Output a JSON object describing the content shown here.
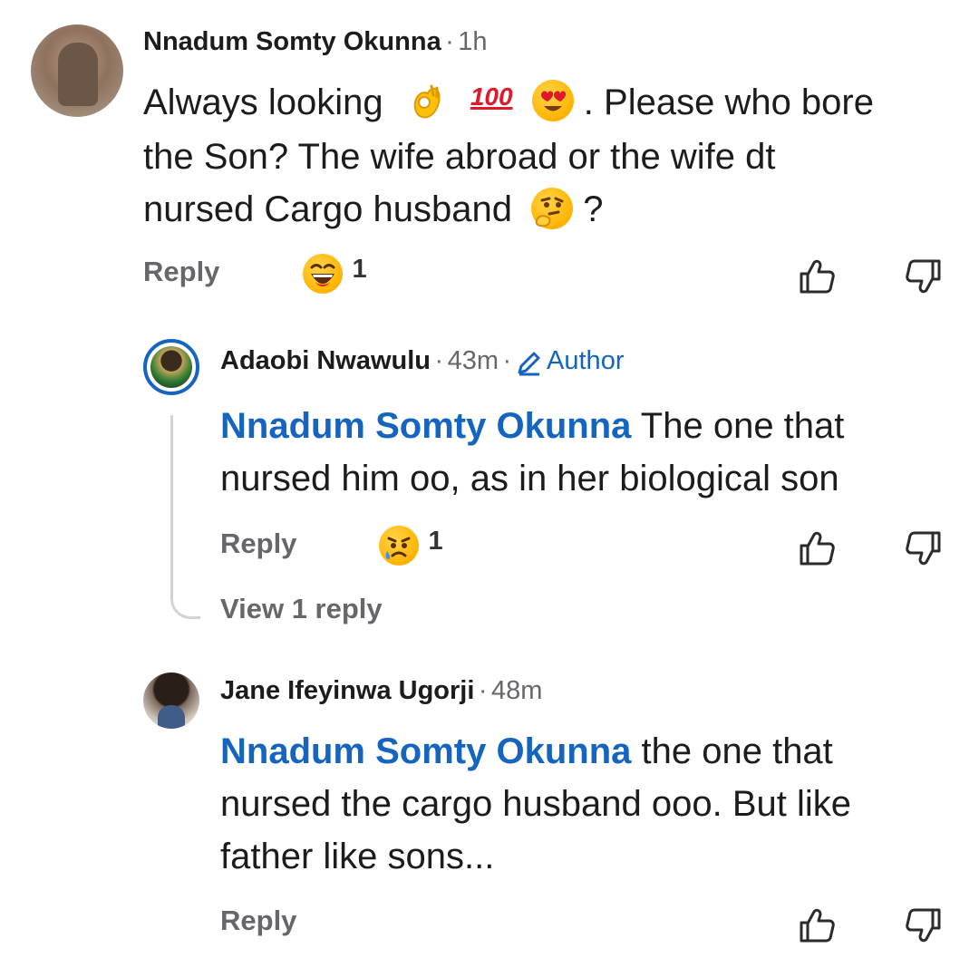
{
  "comments": [
    {
      "author": "Nnadum Somty Okunna",
      "time": "1h",
      "text_parts": {
        "a": "Always looking",
        "b": ".  Please who bore",
        "line2": "the Son? The wife abroad or the wife dt",
        "line3a": "nursed Cargo husband",
        "line3b": "?"
      },
      "hundred": "100",
      "reply_label": "Reply",
      "reaction_count": "1",
      "reaction_icon": "laughing-emoji"
    },
    {
      "author": "Adaobi Nwawulu",
      "time": "43m",
      "author_badge": "Author",
      "mention": "Nnadum Somty Okunna",
      "text_l1": " The one that",
      "text_l2": "nursed him oo, as in her biological son",
      "reply_label": "Reply",
      "reaction_count": "1",
      "reaction_icon": "sad-emoji",
      "view_replies": "View 1 reply"
    },
    {
      "author": "Jane Ifeyinwa Ugorji",
      "time": "48m",
      "mention": "Nnadum Somty Okunna",
      "text_l1": " the one that",
      "text_l2": "nursed the cargo husband ooo. But like",
      "text_l3": "father like sons...",
      "reply_label": "Reply"
    }
  ],
  "separator": "·",
  "colors": {
    "mention": "#1565c0",
    "meta": "#65676b",
    "author_ring": "#1565c0"
  }
}
